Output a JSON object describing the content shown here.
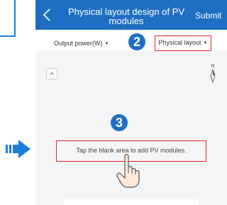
{
  "header": {
    "title_line1": "Physical layout design of PV",
    "title_line2": "modules",
    "submit_label": "Submit"
  },
  "toolbar": {
    "output_power_label": "Output power(W)",
    "physical_layout_label": "Physical layout"
  },
  "steps": {
    "step2": "2",
    "step3": "3"
  },
  "canvas": {
    "hint": "Tap the blank area to add PV modules.",
    "compass_label": "N"
  },
  "colors": {
    "header_bg": "#1e6fc4",
    "highlight": "#e0262e",
    "step_badge": "#1e6fc4",
    "arrow": "#1c7fd9"
  },
  "icons": {
    "back": "chevron-left-icon",
    "collapse": "chevron-up-icon",
    "compass": "compass-icon",
    "hand": "tap-hand-icon",
    "arrow": "right-arrow-icon"
  }
}
